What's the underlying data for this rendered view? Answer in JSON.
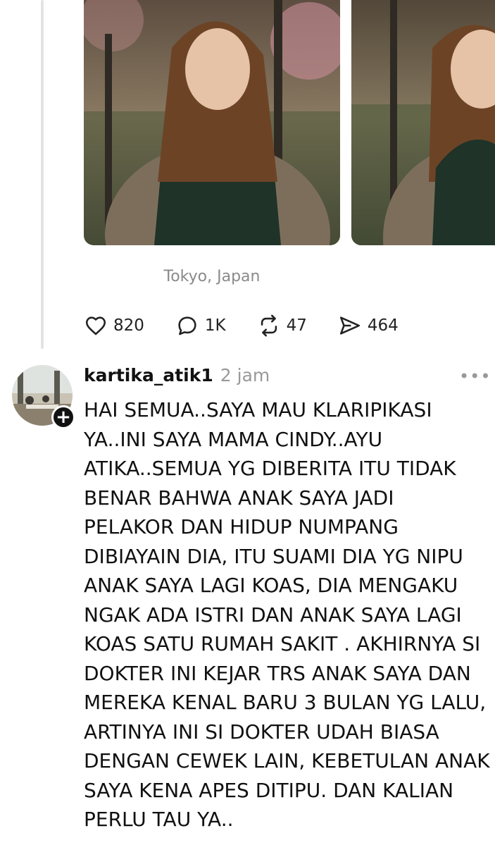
{
  "post": {
    "location": "Tokyo, Japan",
    "likes": "820",
    "replies": "1K",
    "reposts": "47",
    "shares": "464",
    "icons": [
      "heart-icon",
      "reply-icon",
      "repost-icon",
      "share-icon"
    ]
  },
  "reply": {
    "username": "kartika_atik1",
    "time": "2 jam",
    "text": "HAI SEMUA..SAYA MAU KLARIPIKASI\nYA..INI SAYA MAMA CINDY..AYU\nATIKA..SEMUA YG DIBERITA ITU TIDAK\nBENAR BAHWA ANAK SAYA JADI\nPELAKOR DAN HIDUP NUMPANG\nDIBIAYAIN DIA, ITU SUAMI DIA YG NIPU\nANAK SAYA LAGI KOAS, DIA MENGAKU\nNGAK ADA ISTRI DAN ANAK SAYA LAGI\nKOAS SATU RUMAH SAKIT . AKHIRNYA SI\nDOKTER INI KEJAR TRS ANAK SAYA DAN\nMEREKA KENAL BARU 3 BULAN YG LALU,\nARTINYA INI SI DOKTER UDAH BIASA\nDENGAN CEWEK LAIN, KEBETULAN ANAK\nSAYA KENA APES DITIPU. DAN KALIAN\nPERLU TAU YA..",
    "follow_symbol": "+",
    "more_symbol": "•••"
  }
}
